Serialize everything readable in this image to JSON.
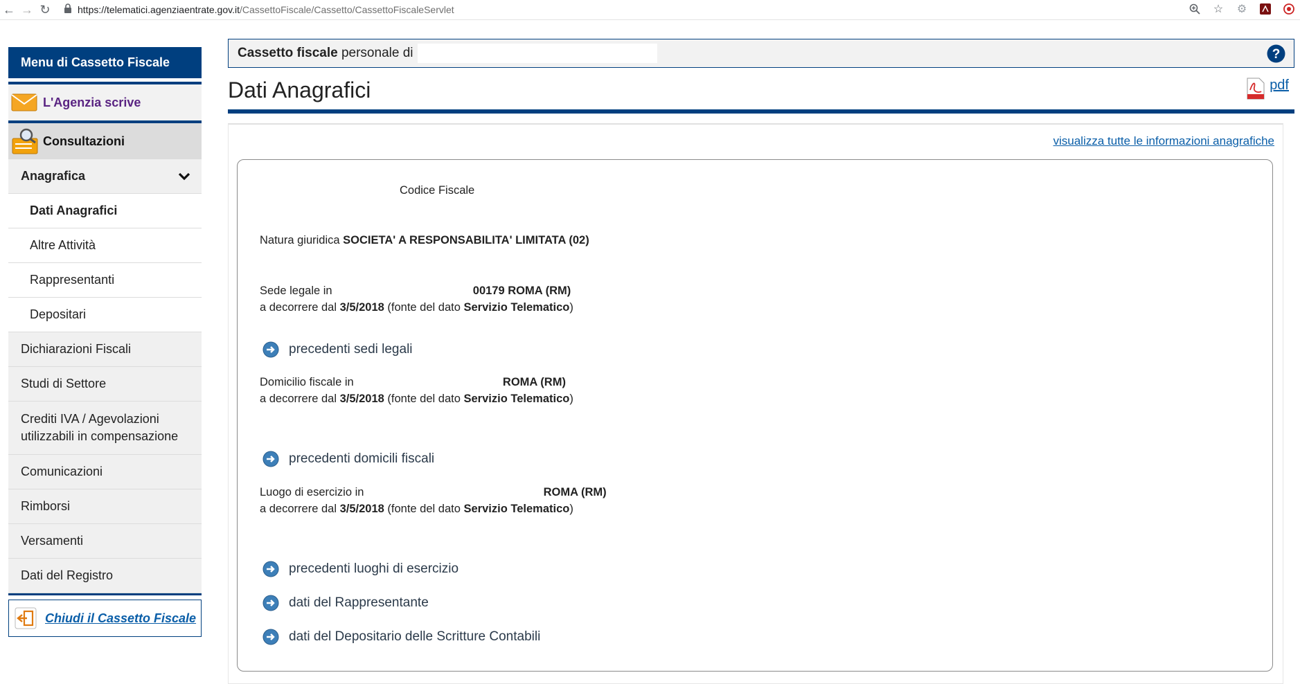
{
  "browser": {
    "url_host": "https://telematici.agenziaentrate.gov.it",
    "url_path": "/CassettoFiscale/Cassetto/CassettoFiscaleServlet"
  },
  "sidebar": {
    "header": "Menu di Cassetto Fiscale",
    "agenzia": "L'Agenzia scrive",
    "consultazioni": "Consultazioni",
    "anagrafica": "Anagrafica",
    "sub_items": [
      "Dati Anagrafici",
      "Altre Attività",
      "Rappresentanti",
      "Depositari"
    ],
    "items": [
      "Dichiarazioni Fiscali",
      "Studi di Settore",
      "Crediti IVA / Agevolazioni utilizzabili in compensazione",
      "Comunicazioni",
      "Rimborsi",
      "Versamenti",
      "Dati del Registro"
    ],
    "chiudi": "Chiudi il Cassetto Fiscale"
  },
  "header": {
    "cassetto_bold": "Cassetto fiscale",
    "cassetto_rest": "personale di"
  },
  "page": {
    "title": "Dati Anagrafici",
    "pdf": "pdf",
    "all_info": "visualizza tutte le informazioni anagrafiche"
  },
  "card": {
    "codice_fiscale": "Codice Fiscale",
    "natura_label": "Natura giuridica",
    "natura_value": "SOCIETA' A RESPONSABILITA' LIMITATA (02)",
    "sede_label": "Sede legale in",
    "sede_value": "00179 ROMA (RM)",
    "decorre_label": "a decorrere dal",
    "decorre_date": "3/5/2018",
    "fonte_label": "(fonte del dato",
    "fonte_value": "Servizio Telematico",
    "fonte_close": ")",
    "link_sedi": "precedenti sedi legali",
    "domicilio_label": "Domicilio fiscale in",
    "domicilio_value": "ROMA (RM)",
    "link_domicili": "precedenti domicili fiscali",
    "luogo_label": "Luogo di esercizio in",
    "luogo_value": "ROMA (RM)",
    "link_luoghi": "precedenti luoghi di esercizio",
    "link_rappresentante": "dati del Rappresentante",
    "link_depositario": "dati del Depositario delle Scritture Contabili"
  }
}
